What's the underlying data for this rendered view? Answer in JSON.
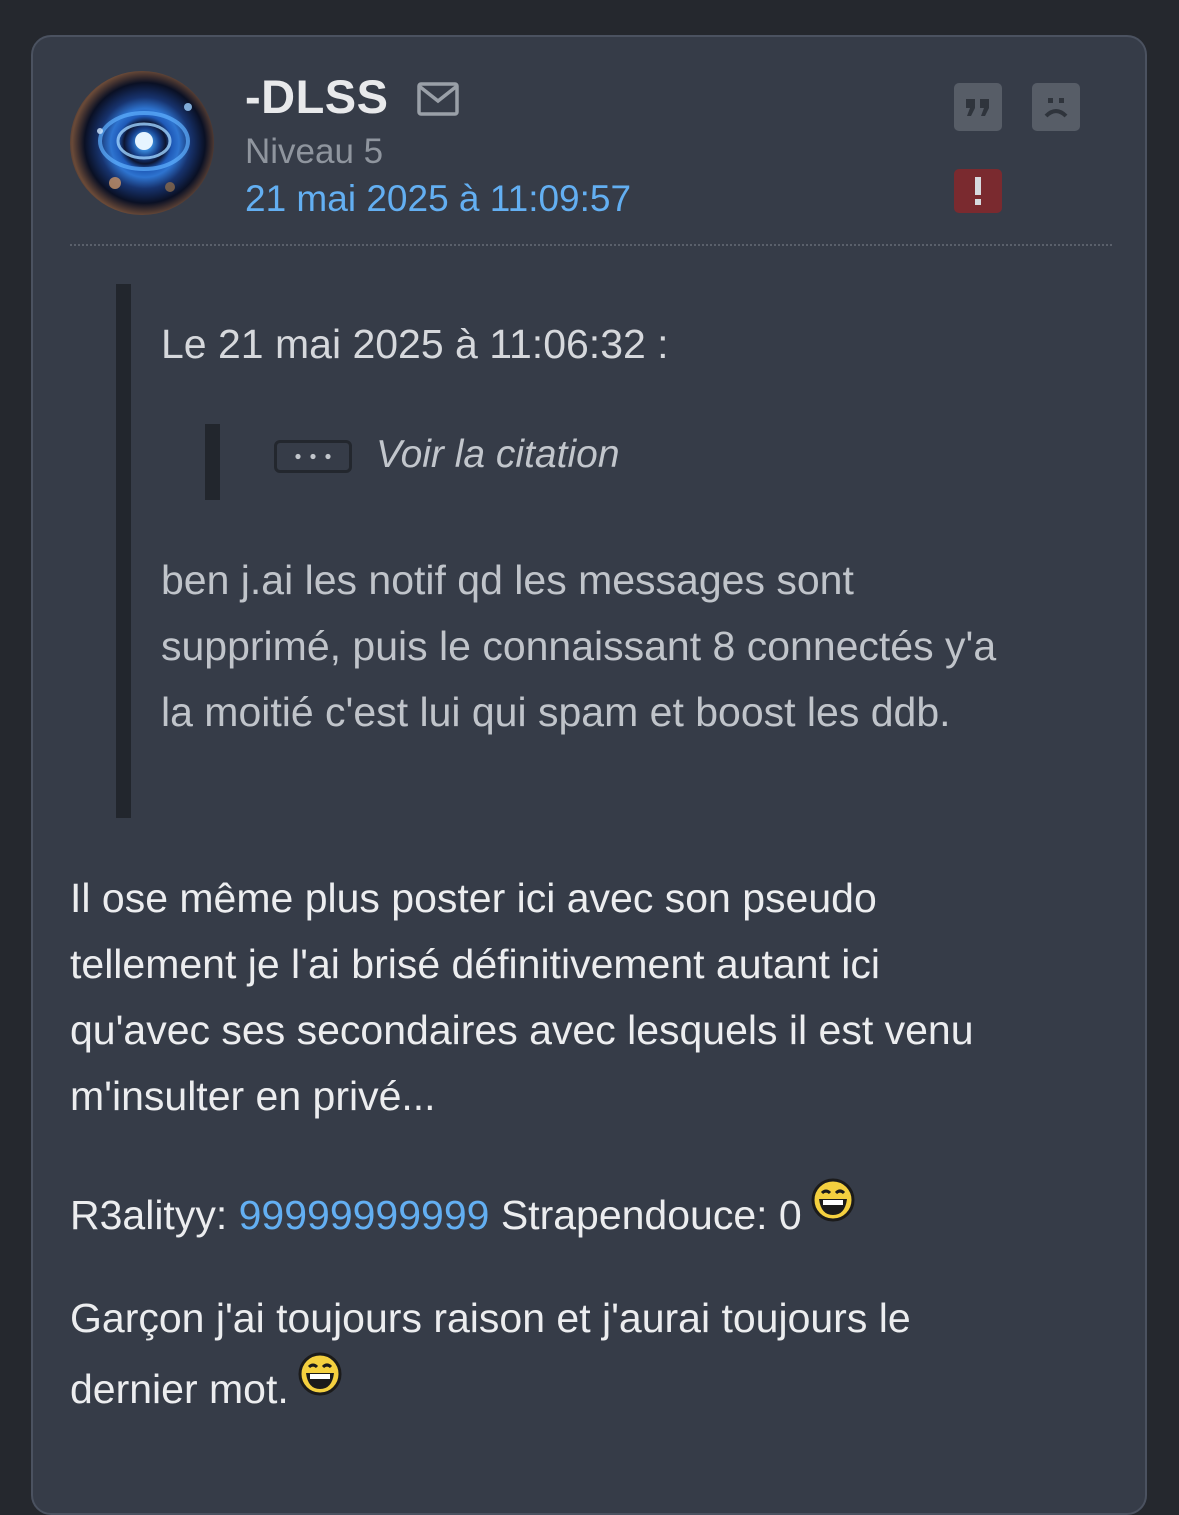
{
  "post": {
    "author": {
      "username": "-DLSS",
      "level": "Niveau 5"
    },
    "date": "21 mai 2025 à 11:09:57",
    "actions": {
      "quote_icon": "quote-icon",
      "sad_icon": "sad-face-icon",
      "report_icon": "exclamation-icon"
    },
    "quote": {
      "header": "Le 21 mai 2025 à 11:06:32 :",
      "nested": {
        "toggle_icon": "ellipsis-icon",
        "label": "Voir la citation"
      },
      "lines": [
        "ben j.ai les notif qd les messages sont",
        "supprimé, puis le connaissant 8 connectés y'a",
        "la moitié c'est lui qui spam et boost les ddb."
      ]
    },
    "body": {
      "paragraph1": [
        "Il ose même plus poster ici avec son pseudo",
        "tellement je l'ai brisé définitivement autant ici",
        "qu'avec ses secondaires avec lesquels il est venu",
        "m'insulter en privé..."
      ],
      "paragraph2": {
        "prefix": "R3alityy: ",
        "number": "99999999999",
        "suffix": " Strapendouce: 0"
      },
      "paragraph3": [
        "Garçon j'ai toujours raison et j'aurai toujours le",
        "dernier mot."
      ],
      "smiley_icon": "laughing-smiley-icon"
    }
  },
  "colors": {
    "background": "#25282e",
    "card": "#363c48",
    "accent_link": "#63aff2",
    "report_red": "#7a2a2f"
  }
}
